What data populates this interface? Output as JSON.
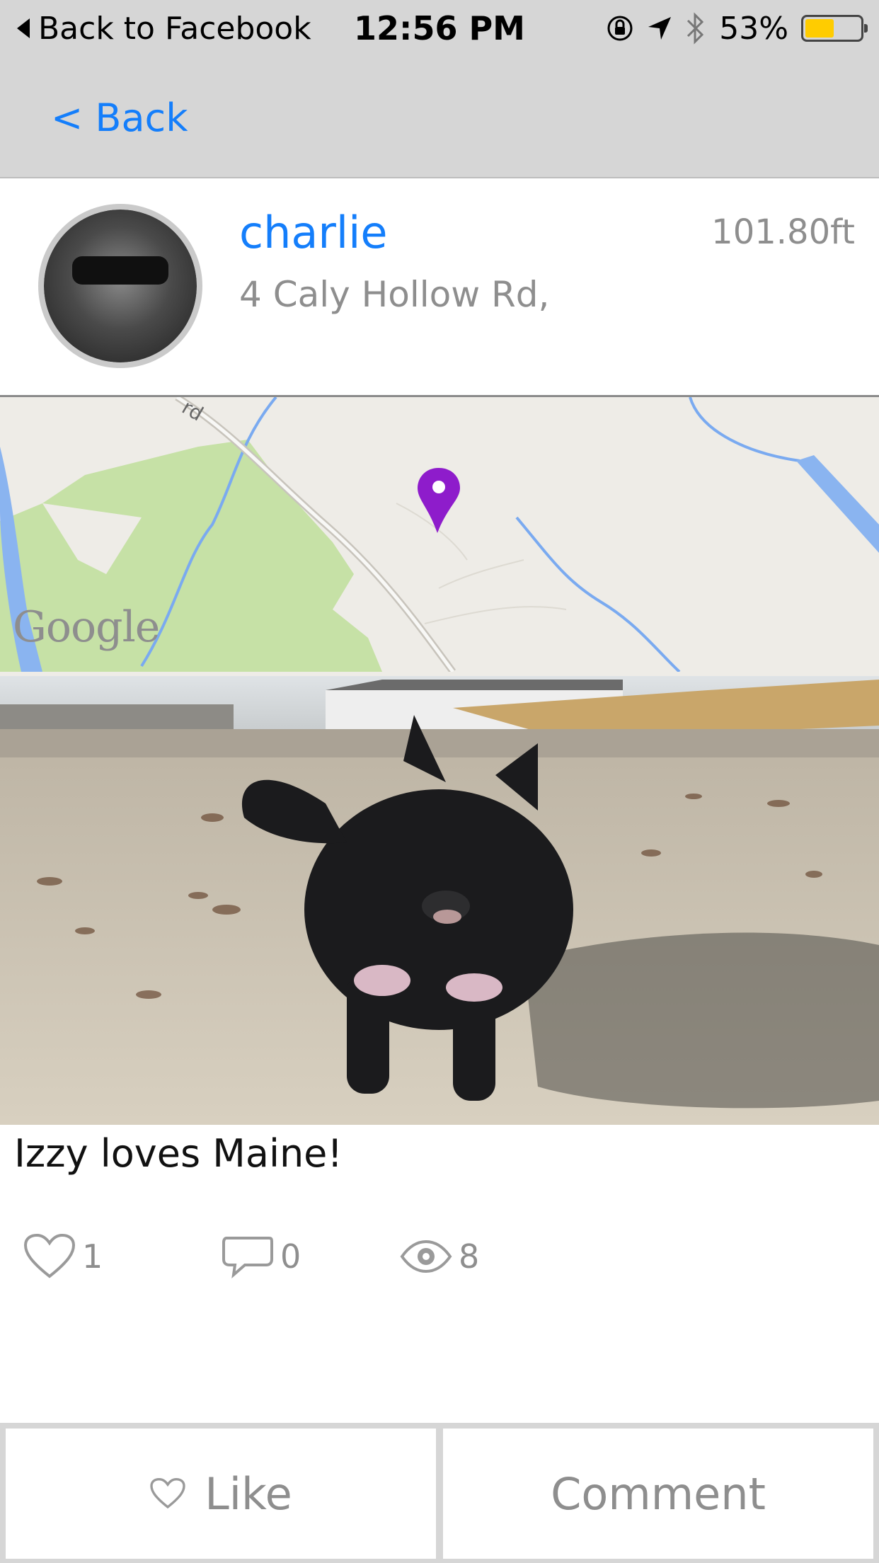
{
  "status_bar": {
    "back_app": "Back to Facebook",
    "time": "12:56 PM",
    "battery": "53%",
    "battery_level": 0.53,
    "battery_color": "#ffcc00"
  },
  "nav": {
    "back_label": "< Back"
  },
  "post": {
    "username": "charlie",
    "distance": "101.80ft",
    "address": "4 Caly Hollow Rd,",
    "caption": "Izzy loves Maine!",
    "likes": "1",
    "comments": "0",
    "views": "8"
  },
  "map": {
    "logo": "Google",
    "pin_color": "#8e1ccb"
  },
  "actions": {
    "like_label": "Like",
    "comment_label": "Comment"
  },
  "colors": {
    "accent": "#147efb",
    "muted": "#8e8e8e"
  }
}
